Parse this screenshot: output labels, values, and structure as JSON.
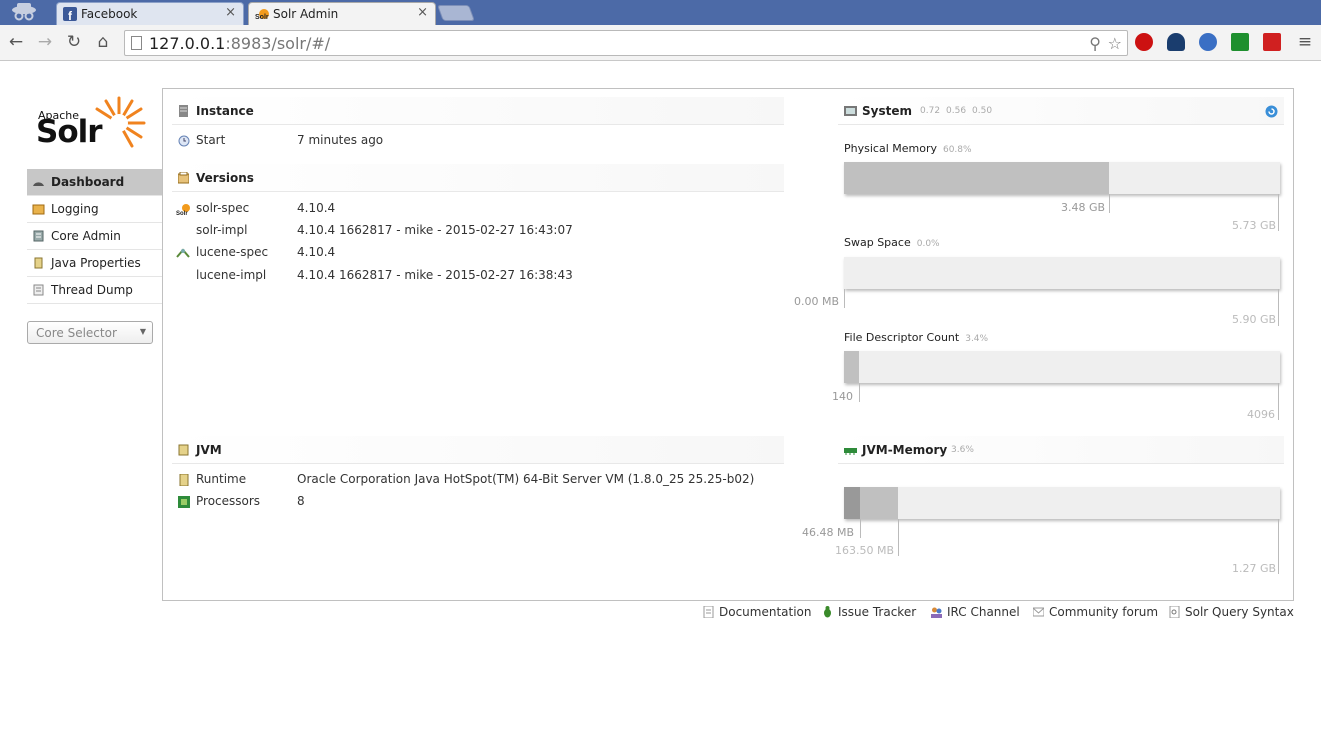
{
  "browser": {
    "tabs": [
      {
        "title": "Facebook",
        "icon": "facebook-icon",
        "active": false
      },
      {
        "title": "Solr Admin",
        "icon": "solr-icon",
        "active": true
      }
    ],
    "url_host": "127.0.0.1",
    "url_rest": ":8983/solr/#/"
  },
  "logo": {
    "apache": "Apache",
    "solr": "Solr"
  },
  "menu": {
    "items": [
      {
        "label": "Dashboard",
        "icon": "dashboard-icon"
      },
      {
        "label": "Logging",
        "icon": "logging-icon"
      },
      {
        "label": "Core Admin",
        "icon": "core-admin-icon"
      },
      {
        "label": "Java Properties",
        "icon": "java-properties-icon"
      },
      {
        "label": "Thread Dump",
        "icon": "thread-dump-icon"
      }
    ],
    "core_selector": "Core Selector"
  },
  "instance": {
    "title": "Instance",
    "start_label": "Start",
    "start_value": "7 minutes ago"
  },
  "versions": {
    "title": "Versions",
    "rows": [
      {
        "label": "solr-spec",
        "value": "4.10.4"
      },
      {
        "label": "solr-impl",
        "value": "4.10.4 1662817 - mike - 2015-02-27 16:43:07"
      },
      {
        "label": "lucene-spec",
        "value": "4.10.4"
      },
      {
        "label": "lucene-impl",
        "value": "4.10.4 1662817 - mike - 2015-02-27 16:38:43"
      }
    ]
  },
  "jvm": {
    "title": "JVM",
    "runtime_label": "Runtime",
    "runtime_value": "Oracle Corporation Java HotSpot(TM) 64-Bit Server VM (1.8.0_25 25.25-b02)",
    "processors_label": "Processors",
    "processors_value": "8"
  },
  "system": {
    "title": "System",
    "load": [
      "0.72",
      "0.56",
      "0.50"
    ],
    "physical_memory": {
      "label": "Physical Memory",
      "pct": "60.8%",
      "used": "3.48 GB",
      "total": "5.73 GB",
      "fraction": 0.608
    },
    "swap_space": {
      "label": "Swap Space",
      "pct": "0.0%",
      "used": "0.00 MB",
      "total": "5.90 GB",
      "fraction": 0.0
    },
    "file_descriptors": {
      "label": "File Descriptor Count",
      "pct": "3.4%",
      "used": "140",
      "total": "4096",
      "fraction": 0.034
    }
  },
  "jvm_memory": {
    "title": "JVM-Memory",
    "pct": "3.6%",
    "used": "46.48 MB",
    "committed": "163.50 MB",
    "max": "1.27 GB",
    "used_fraction": 0.036,
    "committed_fraction": 0.124
  },
  "footer": {
    "links": [
      {
        "label": "Documentation",
        "icon": "documentation-icon"
      },
      {
        "label": "Issue Tracker",
        "icon": "bug-icon"
      },
      {
        "label": "IRC Channel",
        "icon": "irc-icon"
      },
      {
        "label": "Community forum",
        "icon": "mail-icon"
      },
      {
        "label": "Solr Query Syntax",
        "icon": "query-syntax-icon"
      }
    ]
  },
  "colors": {
    "accent": "#d9411e",
    "bar_fill": "#c0c0c0",
    "bar_dark": "#999999",
    "active_menu": "#c7c7c7"
  }
}
